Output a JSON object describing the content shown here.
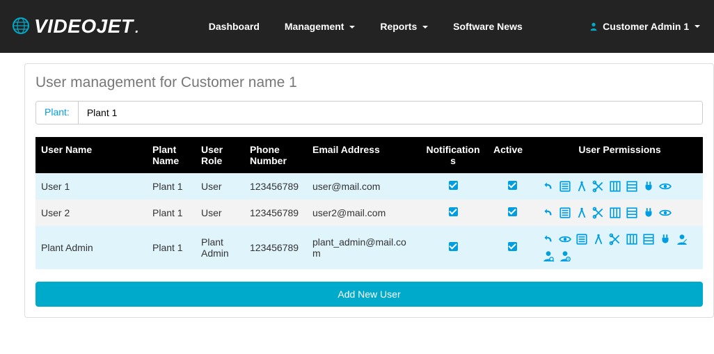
{
  "brand": "VIDEOJET",
  "nav": {
    "dashboard": "Dashboard",
    "management": "Management",
    "reports": "Reports",
    "software_news": "Software News",
    "user": "Customer Admin 1"
  },
  "page": {
    "title": "User management for Customer name 1"
  },
  "filter": {
    "label": "Plant:",
    "value": "Plant 1"
  },
  "table": {
    "headers": {
      "user_name": "User Name",
      "plant_name": "Plant Name",
      "user_role": "User Role",
      "phone": "Phone Number",
      "email": "Email Address",
      "notifications": "Notifications",
      "active": "Active",
      "permissions": "User Permissions"
    },
    "rows": [
      {
        "user_name": "User 1",
        "plant_name": "Plant 1",
        "user_role": "User",
        "phone": "123456789",
        "email": "user@mail.com",
        "notifications": true,
        "active": true,
        "perm_icons": [
          "undo",
          "list",
          "compass",
          "scissors",
          "grid-col",
          "grid-row",
          "plug",
          "eye"
        ]
      },
      {
        "user_name": "User 2",
        "plant_name": "Plant 1",
        "user_role": "User",
        "phone": "123456789",
        "email": "user2@mail.com",
        "notifications": true,
        "active": true,
        "perm_icons": [
          "undo",
          "list",
          "compass",
          "scissors",
          "grid-col",
          "grid-row",
          "plug",
          "eye"
        ]
      },
      {
        "user_name": "Plant Admin",
        "plant_name": "Plant 1",
        "user_role": "Plant Admin",
        "phone": "123456789",
        "email": "plant_admin@mail.com",
        "notifications": true,
        "active": true,
        "perm_icons": [
          "undo",
          "eye",
          "list",
          "compass",
          "scissors",
          "grid-col",
          "grid-row",
          "plug",
          "user-edit",
          "user-search",
          "user-gear"
        ]
      }
    ]
  },
  "actions": {
    "add_user": "Add New User"
  }
}
